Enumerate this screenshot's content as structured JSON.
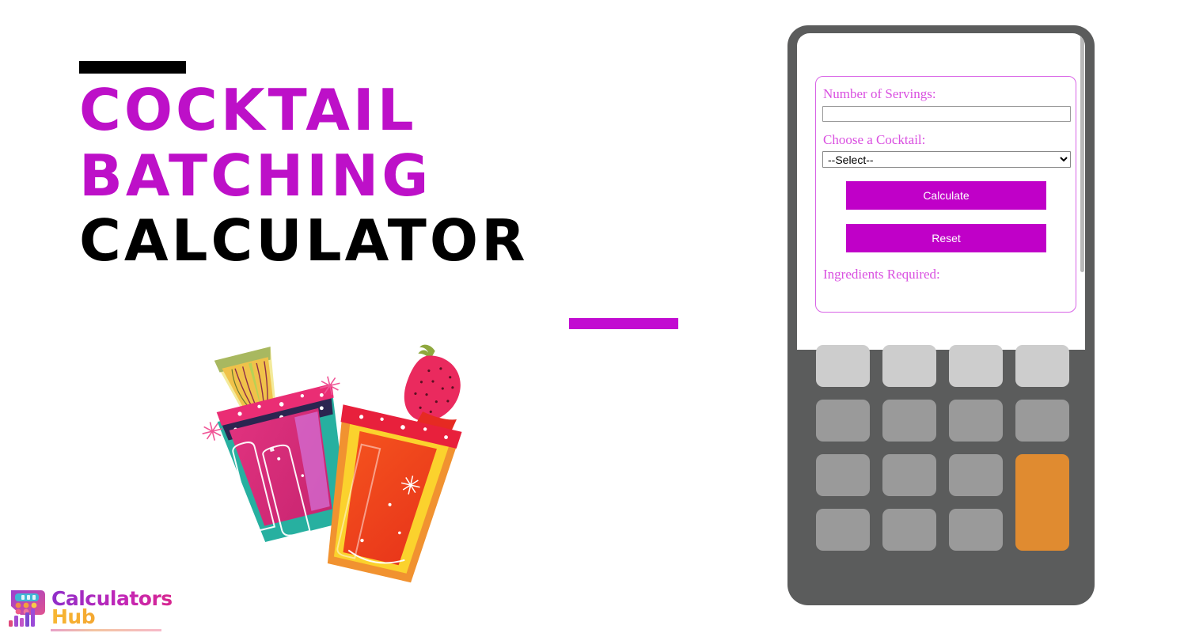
{
  "page": {
    "background_color": "#ffffff",
    "accent_magenta": "#bd10c8",
    "button_magenta": "#c000c8",
    "label_magenta": "#d94fe0",
    "device_gray": "#5b5c5c",
    "key_gray": "#9a9a9a",
    "key_light_gray": "#cdcdcd",
    "key_accent_orange": "#e08b30"
  },
  "hero": {
    "title_lines": [
      {
        "text": "COCKTAIL",
        "color": "#bd10c8"
      },
      {
        "text": "BATCHING",
        "color": "#bd10c8"
      },
      {
        "text": "CALCULATOR",
        "color": "#000000"
      }
    ],
    "rule_top": {
      "name": "black-rule",
      "color": "#000000"
    },
    "rule_bottom": {
      "name": "magenta-rule",
      "color": "#c20bd1"
    },
    "illustration_alt": "two tilted cocktail glasses with lime wheel and strawberry garnish"
  },
  "logo": {
    "word_1": "Calculators",
    "word_2": "Hub",
    "mark_alt": "calculator with bar chart logo mark"
  },
  "calculator": {
    "screen": {
      "form": {
        "servings": {
          "label": "Number of Servings:",
          "value": "",
          "placeholder": ""
        },
        "cocktail": {
          "label": "Choose a Cocktail:",
          "selected": "--Select--",
          "options": [
            "--Select--"
          ]
        },
        "buttons": {
          "calculate": "Calculate",
          "reset": "Reset"
        },
        "results": {
          "label": "Ingredients Required:",
          "value": ""
        }
      }
    },
    "keypad": {
      "rows": [
        [
          {
            "name": "key-1",
            "style": "light",
            "label": ""
          },
          {
            "name": "key-2",
            "style": "light",
            "label": ""
          },
          {
            "name": "key-3",
            "style": "light",
            "label": ""
          },
          {
            "name": "key-4",
            "style": "light",
            "label": ""
          }
        ],
        [
          {
            "name": "key-5",
            "style": "gray",
            "label": ""
          },
          {
            "name": "key-6",
            "style": "gray",
            "label": ""
          },
          {
            "name": "key-7",
            "style": "gray",
            "label": ""
          },
          {
            "name": "key-8",
            "style": "gray",
            "label": ""
          }
        ],
        [
          {
            "name": "key-9",
            "style": "gray",
            "label": ""
          },
          {
            "name": "key-10",
            "style": "gray",
            "label": ""
          },
          {
            "name": "key-11",
            "style": "gray",
            "label": ""
          },
          {
            "name": "key-equals",
            "style": "accent",
            "label": ""
          }
        ],
        [
          {
            "name": "key-12",
            "style": "gray",
            "label": ""
          },
          {
            "name": "key-13",
            "style": "gray",
            "label": ""
          },
          {
            "name": "key-14",
            "style": "gray",
            "label": ""
          }
        ]
      ]
    }
  }
}
